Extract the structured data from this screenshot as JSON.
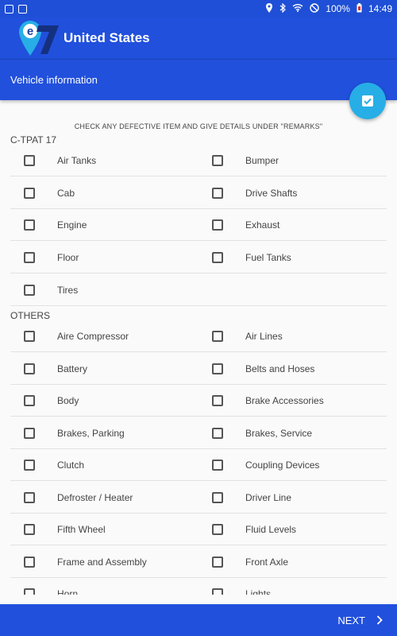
{
  "status": {
    "time": "14:49",
    "battery": "100%"
  },
  "app": {
    "title": "United States",
    "logo_text": "e7"
  },
  "subheader": {
    "title": "Vehicle information"
  },
  "instruction": "CHECK ANY DEFECTIVE ITEM AND GIVE DETAILS UNDER \"REMARKS\"",
  "sections": {
    "ctpat": {
      "title": "C-TPAT 17",
      "rows": [
        [
          "Air Tanks",
          "Bumper"
        ],
        [
          "Cab",
          "Drive Shafts"
        ],
        [
          "Engine",
          "Exhaust"
        ],
        [
          "Floor",
          "Fuel Tanks"
        ],
        [
          "Tires",
          ""
        ]
      ]
    },
    "others": {
      "title": "OTHERS",
      "rows": [
        [
          "Aire Compressor",
          "Air Lines"
        ],
        [
          "Battery",
          "Belts and Hoses"
        ],
        [
          "Body",
          "Brake Accessories"
        ],
        [
          "Brakes, Parking",
          "Brakes, Service"
        ],
        [
          "Clutch",
          "Coupling Devices"
        ],
        [
          "Defroster / Heater",
          "Driver Line"
        ],
        [
          "Fifth Wheel",
          "Fluid Levels"
        ],
        [
          "Frame and Assembly",
          "Front Axle"
        ],
        [
          "Horn",
          "Lights"
        ]
      ]
    }
  },
  "footer": {
    "next_label": "NEXT"
  },
  "colors": {
    "primary": "#2150dc",
    "accent": "#27aee6"
  }
}
